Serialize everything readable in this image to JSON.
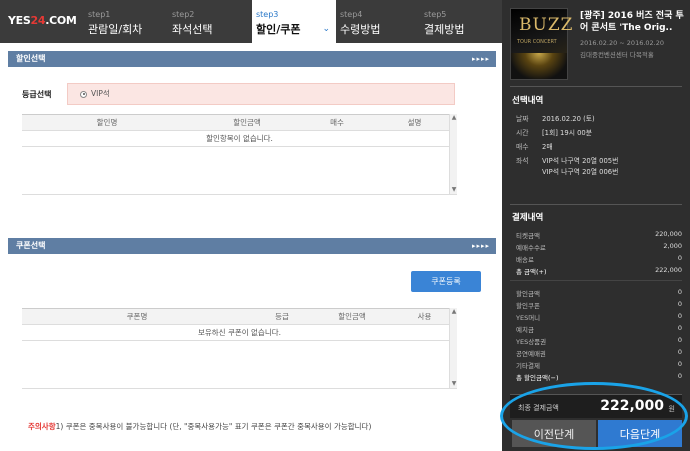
{
  "logo": {
    "text_a": "YES",
    "text_b": "24",
    "text_c": ".COM"
  },
  "steps": [
    {
      "num": "step1",
      "label": "관람일/회차"
    },
    {
      "num": "step2",
      "label": "좌석선택"
    },
    {
      "num": "step3",
      "label": "할인/쿠폰"
    },
    {
      "num": "step4",
      "label": "수령방법"
    },
    {
      "num": "step5",
      "label": "결제방법"
    }
  ],
  "discount": {
    "section_title": "할인선택",
    "grade_label": "등급선택",
    "grade_option": "VIP석",
    "columns": [
      "할인명",
      "할인금액",
      "매수",
      "설명"
    ],
    "empty_message": "할인항목이 없습니다."
  },
  "coupon": {
    "section_title": "쿠폰선택",
    "register_button": "쿠폰등록",
    "columns": [
      "쿠폰명",
      "등급",
      "할인금액",
      "사용"
    ],
    "empty_message": "보유하신 쿠폰이 없습니다."
  },
  "note": {
    "prefix": "주의사항",
    "text": "1) 쿠폰은 중복사용이 불가능합니다 (단, \"중복사용가능\" 표기 쿠폰은 쿠폰간 중복사용이 가능합니다)"
  },
  "show": {
    "poster_text": "BUZZ",
    "poster_sub": "TOUR CONCERT",
    "title": "[광주] 2016 버즈 전국 투어 콘서트 'The Orig..",
    "date_range": "2016.02.20 ~ 2016.02.20",
    "venue": "김대중컨벤션센터 다목적홀"
  },
  "selection": {
    "title": "선택내역",
    "date_key": "날짜",
    "date_val": "2016.02.20 (토)",
    "time_key": "시간",
    "time_val": "[1회] 19시 00분",
    "count_key": "매수",
    "count_val": "2매",
    "seat_key": "좌석",
    "seat_val1": "VIP석 나구역 20열 005번",
    "seat_val2": "VIP석 나구역 20열 006번"
  },
  "payment": {
    "title": "결제내역",
    "rows": [
      {
        "label": "티켓금액",
        "value": "220,000"
      },
      {
        "label": "예매수수료",
        "value": "2,000"
      },
      {
        "label": "배송료",
        "value": "0"
      },
      {
        "label": "총 금액(+)",
        "value": "222,000"
      }
    ],
    "discount_rows": [
      {
        "label": "할인금액",
        "value": "0"
      },
      {
        "label": "할인쿠폰",
        "value": "0"
      },
      {
        "label": "YES머니",
        "value": "0"
      },
      {
        "label": "예치금",
        "value": "0"
      },
      {
        "label": "YES상품권",
        "value": "0"
      },
      {
        "label": "공연예매권",
        "value": "0"
      },
      {
        "label": "기타결제",
        "value": "0"
      },
      {
        "label": "총 할인금액(−)",
        "value": "0"
      }
    ],
    "total_label": "최종 결제금액",
    "total_amount": "222,000",
    "currency": "원"
  },
  "buttons": {
    "prev": "이전단계",
    "next": "다음단계"
  },
  "colors": {
    "accent": "#2f7ad1",
    "highlight": "#1aa3e8",
    "section_bar": "#5f7ea3"
  }
}
